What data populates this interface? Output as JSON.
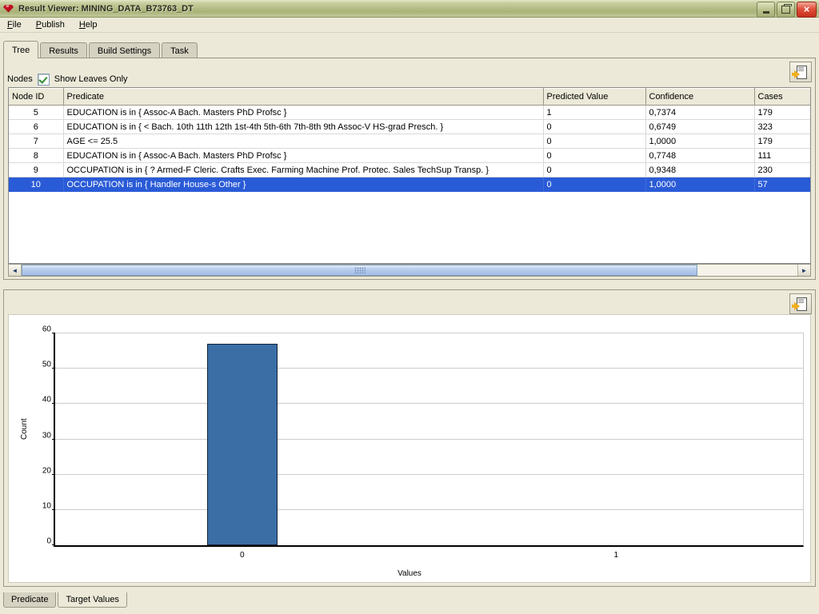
{
  "window": {
    "title": "Result Viewer: MINING_DATA_B73763_DT",
    "icon": "gem-icon",
    "buttons": {
      "minimize": "minimize-button",
      "restore": "restore-button",
      "close": "close-button"
    }
  },
  "menubar": {
    "items": [
      {
        "label": "File",
        "mnemonic": "F"
      },
      {
        "label": "Publish",
        "mnemonic": "P"
      },
      {
        "label": "Help",
        "mnemonic": "H"
      }
    ]
  },
  "tabs": {
    "items": [
      {
        "label": "Tree",
        "active": true
      },
      {
        "label": "Results",
        "active": false
      },
      {
        "label": "Build Settings",
        "active": false
      },
      {
        "label": "Task",
        "active": false
      }
    ]
  },
  "nodes_panel": {
    "label": "Nodes",
    "checkbox": {
      "label": "Show Leaves Only",
      "checked": true
    },
    "export_button_tooltip": "Export",
    "table": {
      "columns": [
        "Node ID",
        "Predicate",
        "Predicted Value",
        "Confidence",
        "Cases"
      ],
      "rows": [
        {
          "node_id": "5",
          "predicate": "EDUCATION is in { Assoc-A Bach. Masters PhD Profsc }",
          "predicted_value": "1",
          "confidence": "0,7374",
          "cases": "179",
          "selected": false
        },
        {
          "node_id": "6",
          "predicate": "EDUCATION is in { < Bach. 10th 11th 12th 1st-4th 5th-6th 7th-8th 9th Assoc-V HS-grad Presch. }",
          "predicted_value": "0",
          "confidence": "0,6749",
          "cases": "323",
          "selected": false
        },
        {
          "node_id": "7",
          "predicate": "AGE <= 25.5",
          "predicted_value": "0",
          "confidence": "1,0000",
          "cases": "179",
          "selected": false
        },
        {
          "node_id": "8",
          "predicate": "EDUCATION is in { Assoc-A Bach. Masters PhD Profsc }",
          "predicted_value": "0",
          "confidence": "0,7748",
          "cases": "111",
          "selected": false
        },
        {
          "node_id": "9",
          "predicate": "OCCUPATION is in { ? Armed-F Cleric. Crafts Exec. Farming Machine Prof. Protec. Sales TechSup Transp. }",
          "predicted_value": "0",
          "confidence": "0,9348",
          "cases": "230",
          "selected": false
        },
        {
          "node_id": "10",
          "predicate": "OCCUPATION is in { Handler House-s Other }",
          "predicted_value": "0",
          "confidence": "1,0000",
          "cases": "57",
          "selected": true
        }
      ]
    },
    "scrollbar": {
      "left_arrow": "◄",
      "right_arrow": "►"
    }
  },
  "chart_panel": {
    "export_button_tooltip": "Export"
  },
  "chart_data": {
    "type": "bar",
    "title": "",
    "categories": [
      "0",
      "1"
    ],
    "values": [
      57,
      0
    ],
    "xlabel": "Values",
    "ylabel": "Count",
    "ylim": [
      0,
      60
    ],
    "yticks": [
      0,
      10,
      20,
      30,
      40,
      50,
      60
    ],
    "grid": true,
    "legend": "none",
    "bar_color": "#3a6ea5",
    "bar_border_color": "#12233b"
  },
  "bottom_tabs": {
    "items": [
      {
        "label": "Predicate",
        "active": true
      },
      {
        "label": "Target Values",
        "active": false
      }
    ]
  },
  "colors": {
    "titlebar": "#b3bb84",
    "window_bg": "#ece9d8",
    "selection": "#2a5bd7",
    "accent_bar": "#3a6ea5"
  }
}
